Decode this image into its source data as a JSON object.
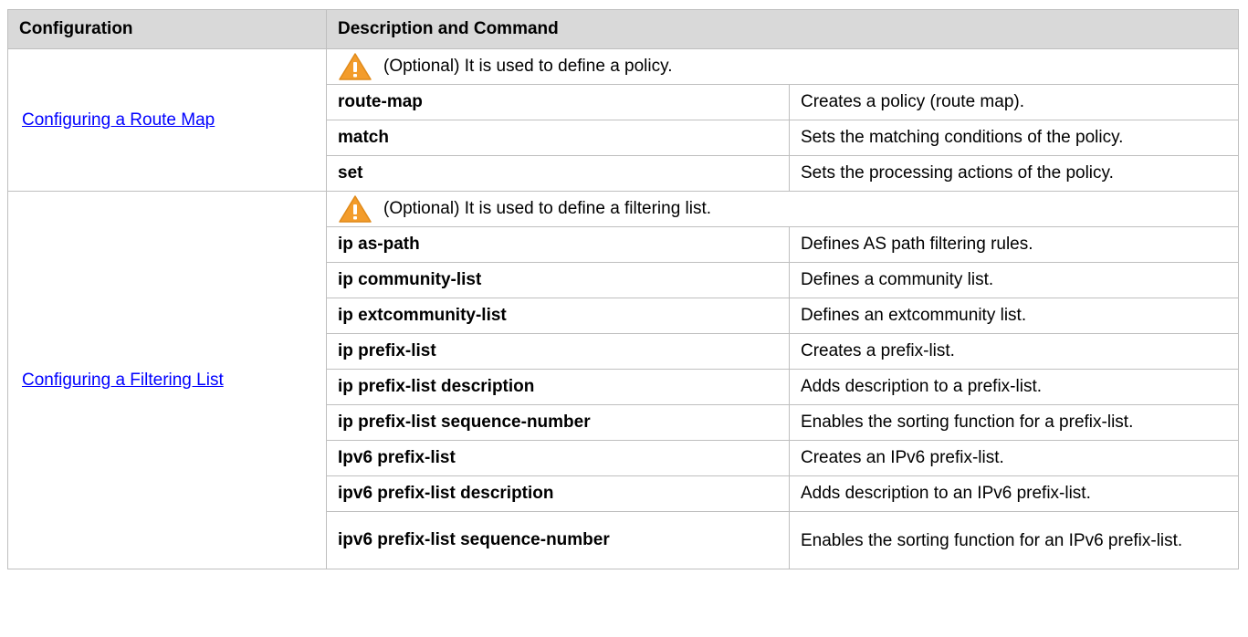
{
  "table": {
    "headers": [
      "Configuration",
      "Description and Command"
    ],
    "sections": [
      {
        "config_link": "Configuring a Route Map",
        "note": "(Optional) It is used to define a policy.",
        "rows": [
          {
            "command": "route-map",
            "description": "Creates a policy (route map)."
          },
          {
            "command": "match",
            "description": "Sets the matching conditions of the policy."
          },
          {
            "command": "set",
            "description": "Sets the processing actions of the policy."
          }
        ]
      },
      {
        "config_link": "Configuring a Filtering List",
        "note": "(Optional) It is used to define a filtering list.",
        "rows": [
          {
            "command": "ip as-path",
            "description": "Defines AS path filtering rules."
          },
          {
            "command": "ip community-list",
            "description": "Defines a community list."
          },
          {
            "command": "ip extcommunity-list",
            "description": "Defines an extcommunity list."
          },
          {
            "command": "ip prefix-list",
            "description": "Creates a prefix-list."
          },
          {
            "command": "ip prefix-list description",
            "description": "Adds description to a prefix-list."
          },
          {
            "command": "ip prefix-list sequence-number",
            "description": "Enables the sorting function for a prefix-list."
          },
          {
            "command": "Ipv6 prefix-list",
            "description": "Creates an IPv6 prefix-list."
          },
          {
            "command": "ipv6 prefix-list description",
            "description": "Adds description to an IPv6 prefix-list."
          },
          {
            "command": "ipv6 prefix-list sequence-number",
            "description": "Enables the sorting function for an IPv6 prefix-list."
          }
        ]
      }
    ]
  },
  "colors": {
    "header_bg": "#d9d9d9",
    "border": "#bfbfbf",
    "link": "#0000ff",
    "warning_icon": "#f39c2b"
  },
  "icons": {
    "note": "warning-icon"
  }
}
